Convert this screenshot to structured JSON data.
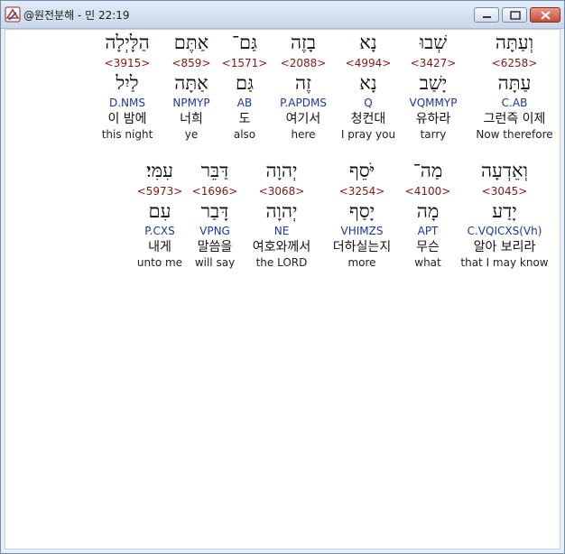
{
  "window": {
    "title": "@원전분해 - 민 22:19"
  },
  "rows": [
    [
      {
        "heb": "וְעַתָּה",
        "code": "<6258>",
        "root": "עַתָּה",
        "morph": "C.AB",
        "kor": "그런즉 이제",
        "eng": "Now therefore"
      },
      {
        "heb": "שְׁבוּ",
        "code": "<3427>",
        "root": "יָשַׁב",
        "morph": "VQMMYP",
        "kor": "유하라",
        "eng": "tarry"
      },
      {
        "heb": "נָא",
        "code": "<4994>",
        "root": "נָא",
        "morph": "Q",
        "kor": "청컨대",
        "eng": "I pray you"
      },
      {
        "heb": "בָזֶה",
        "code": "<2088>",
        "root": "זֶה",
        "morph": "P.APDMS",
        "kor": "여기서",
        "eng": "here"
      },
      {
        "heb": "גַּם־",
        "code": "<1571>",
        "root": "גַּם",
        "morph": "AB",
        "kor": "도",
        "eng": "also"
      },
      {
        "heb": "אַתֶּם",
        "code": "<859>",
        "root": "אַתָּה",
        "morph": "NPMYP",
        "kor": "너희",
        "eng": "ye"
      },
      {
        "heb": "הַלָּיְלָה",
        "code": "<3915>",
        "root": "לַיִל",
        "morph": "D.NMS",
        "kor": "이 밤에",
        "eng": "this night"
      }
    ],
    [
      {
        "heb": "וְאֵדְעָה",
        "code": "<3045>",
        "root": "יָדַע",
        "morph": "C.VQICXS(Vh)",
        "kor": "알아 보리라",
        "eng": "that I may know"
      },
      {
        "heb": "מַה־",
        "code": "<4100>",
        "root": "מָה",
        "morph": "APT",
        "kor": "무슨",
        "eng": "what"
      },
      {
        "heb": "יֹּסֵף",
        "code": "<3254>",
        "root": "יָסַף",
        "morph": "VHIMZS",
        "kor": "더하실는지",
        "eng": "more"
      },
      {
        "heb": "יְהוָה",
        "code": "<3068>",
        "root": "יְהוָה",
        "morph": "NE",
        "kor": "여호와께서",
        "eng": "the LORD"
      },
      {
        "heb": "דַּבֵּר",
        "code": "<1696>",
        "root": "דָּבַר",
        "morph": "VPNG",
        "kor": "말씀을",
        "eng": "will say"
      },
      {
        "heb": "עִמִּי׃",
        "code": "<5973>",
        "root": "עִם",
        "morph": "P.CXS",
        "kor": "내게",
        "eng": "unto me"
      }
    ]
  ]
}
